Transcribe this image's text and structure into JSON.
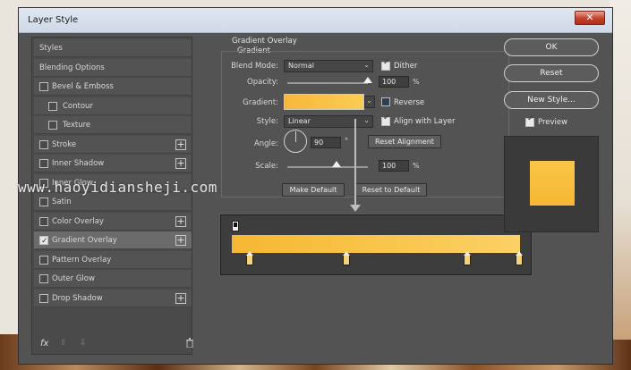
{
  "window": {
    "title": "Layer Style",
    "close_label": "✕"
  },
  "styles_list": [
    {
      "label": "Styles",
      "checkbox": false,
      "plus": false,
      "checked": false,
      "selected": false,
      "indent": false
    },
    {
      "label": "Blending Options",
      "checkbox": false,
      "plus": false,
      "checked": false,
      "selected": false,
      "indent": false
    },
    {
      "label": "Bevel & Emboss",
      "checkbox": true,
      "plus": false,
      "checked": false,
      "selected": false,
      "indent": false
    },
    {
      "label": "Contour",
      "checkbox": true,
      "plus": false,
      "checked": false,
      "selected": false,
      "indent": true
    },
    {
      "label": "Texture",
      "checkbox": true,
      "plus": false,
      "checked": false,
      "selected": false,
      "indent": true
    },
    {
      "label": "Stroke",
      "checkbox": true,
      "plus": true,
      "checked": false,
      "selected": false,
      "indent": false
    },
    {
      "label": "Inner Shadow",
      "checkbox": true,
      "plus": true,
      "checked": false,
      "selected": false,
      "indent": false
    },
    {
      "label": "Inner Glow",
      "checkbox": true,
      "plus": false,
      "checked": false,
      "selected": false,
      "indent": false
    },
    {
      "label": "Satin",
      "checkbox": true,
      "plus": false,
      "checked": false,
      "selected": false,
      "indent": false
    },
    {
      "label": "Color Overlay",
      "checkbox": true,
      "plus": true,
      "checked": false,
      "selected": false,
      "indent": false
    },
    {
      "label": "Gradient Overlay",
      "checkbox": true,
      "plus": true,
      "checked": true,
      "selected": true,
      "indent": false
    },
    {
      "label": "Pattern Overlay",
      "checkbox": true,
      "plus": false,
      "checked": false,
      "selected": false,
      "indent": false
    },
    {
      "label": "Outer Glow",
      "checkbox": true,
      "plus": false,
      "checked": false,
      "selected": false,
      "indent": false
    },
    {
      "label": "Drop Shadow",
      "checkbox": true,
      "plus": true,
      "checked": false,
      "selected": false,
      "indent": false
    }
  ],
  "footer": {
    "fx_label": "fx",
    "up_arrow": "⇧",
    "down_arrow": "⇩",
    "trash": "🗑"
  },
  "gradient_overlay": {
    "section_title": "Gradient Overlay",
    "subsection_title": "Gradient",
    "blend_mode_label": "Blend Mode:",
    "blend_mode_value": "Normal",
    "dither_label": "Dither",
    "dither_checked": true,
    "opacity_label": "Opacity:",
    "opacity_value": "100",
    "opacity_unit": "%",
    "gradient_label": "Gradient:",
    "gradient_colors": [
      "#f6b733",
      "#fcd066"
    ],
    "reverse_label": "Reverse",
    "reverse_checked": false,
    "style_label": "Style:",
    "style_value": "Linear",
    "align_label": "Align with Layer",
    "align_checked": true,
    "angle_label": "Angle:",
    "angle_value": "90",
    "angle_unit": "°",
    "reset_alignment_label": "Reset Alignment",
    "scale_label": "Scale:",
    "scale_value": "100",
    "scale_unit": "%",
    "make_default_label": "Make Default",
    "reset_default_label": "Reset to Default"
  },
  "right_panel": {
    "ok_label": "OK",
    "reset_label": "Reset",
    "new_style_label": "New Style...",
    "preview_label": "Preview",
    "preview_checked": true
  },
  "watermark": "www.haoyidiansheji.com",
  "colors": {
    "accent": "#f6b733",
    "panel": "#535353",
    "titlebar": "#dfe7f1",
    "close": "#c4402a"
  }
}
